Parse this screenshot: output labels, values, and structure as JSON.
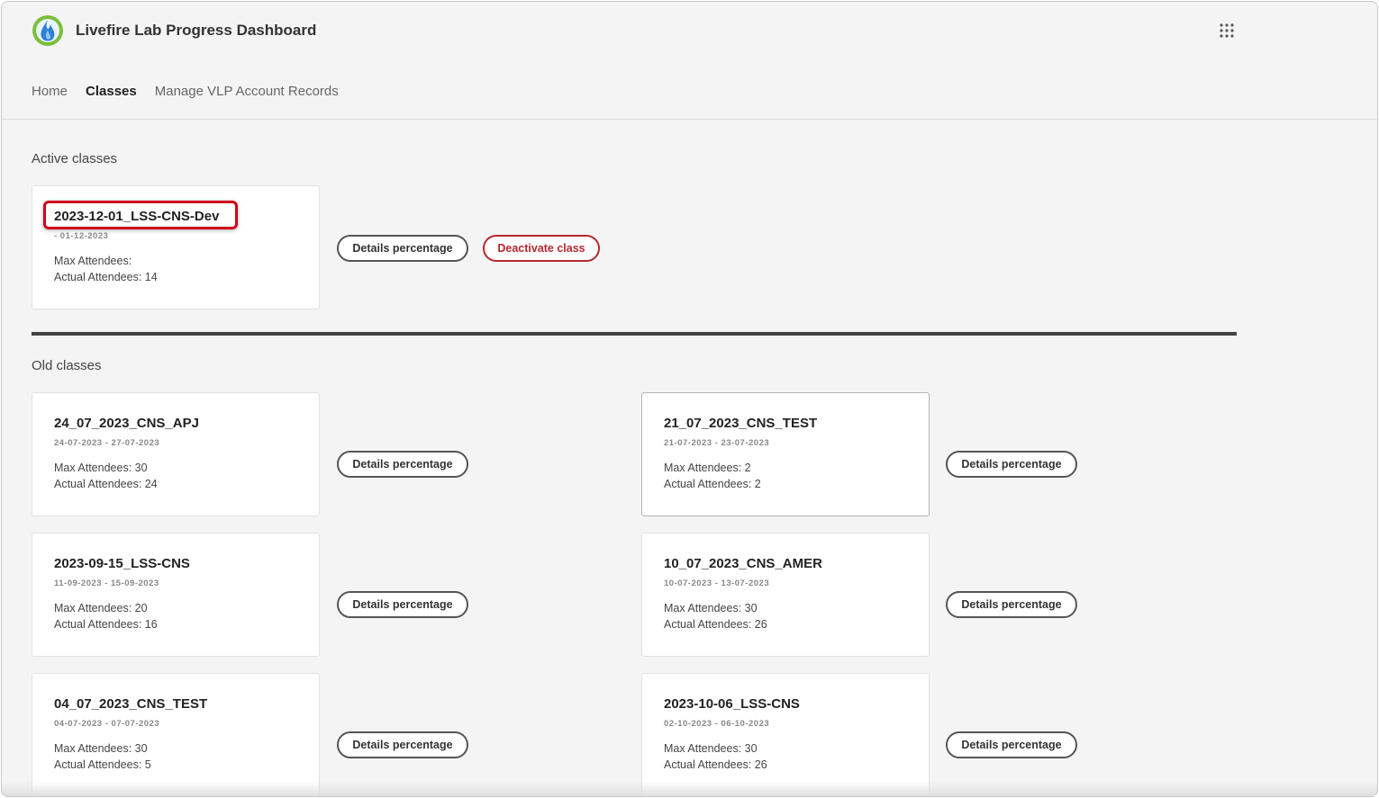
{
  "app": {
    "title": "Livefire Lab Progress Dashboard"
  },
  "nav": {
    "items": [
      {
        "label": "Home"
      },
      {
        "label": "Classes"
      },
      {
        "label": "Manage VLP Account Records"
      }
    ]
  },
  "sections": {
    "active_title": "Active classes",
    "old_title": "Old classes"
  },
  "active_class": {
    "name": "2023-12-01_LSS-CNS-Dev",
    "dates": "- 01-12-2023",
    "max": "Max Attendees:",
    "actual": "Actual Attendees: 14",
    "details_label": "Details percentage",
    "deactivate_label": "Deactivate class"
  },
  "old_classes": [
    {
      "name": "24_07_2023_CNS_APJ",
      "dates": "24-07-2023 - 27-07-2023",
      "max": "Max Attendees: 30",
      "actual": "Actual Attendees: 24",
      "details_label": "Details percentage"
    },
    {
      "name": "21_07_2023_CNS_TEST",
      "dates": "21-07-2023 - 23-07-2023",
      "max": "Max Attendees: 2",
      "actual": "Actual Attendees: 2",
      "details_label": "Details percentage"
    },
    {
      "name": "2023-09-15_LSS-CNS",
      "dates": "11-09-2023 - 15-09-2023",
      "max": "Max Attendees: 20",
      "actual": "Actual Attendees: 16",
      "details_label": "Details percentage"
    },
    {
      "name": "10_07_2023_CNS_AMER",
      "dates": "10-07-2023 - 13-07-2023",
      "max": "Max Attendees: 30",
      "actual": "Actual Attendees: 26",
      "details_label": "Details percentage"
    },
    {
      "name": "04_07_2023_CNS_TEST",
      "dates": "04-07-2023 - 07-07-2023",
      "max": "Max Attendees: 30",
      "actual": "Actual Attendees: 5",
      "details_label": "Details percentage"
    },
    {
      "name": "2023-10-06_LSS-CNS",
      "dates": "02-10-2023 - 06-10-2023",
      "max": "Max Attendees: 30",
      "actual": "Actual Attendees: 26",
      "details_label": "Details percentage"
    }
  ],
  "colors": {
    "accent_danger": "#b5282e",
    "highlight": "#d0021b",
    "background": "#f4f4f4"
  },
  "icons": {
    "logo": "flame-globe-logo",
    "apps": "grid-apps-icon"
  }
}
